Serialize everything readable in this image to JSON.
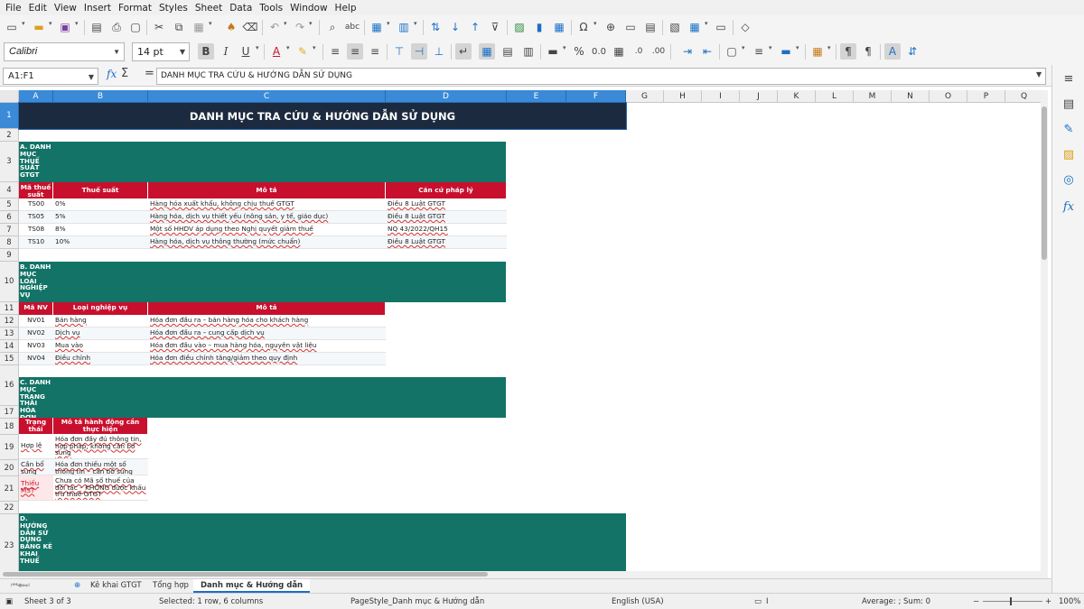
{
  "menu": [
    "File",
    "Edit",
    "View",
    "Insert",
    "Format",
    "Styles",
    "Sheet",
    "Data",
    "Tools",
    "Window",
    "Help"
  ],
  "toolbar": {
    "font_name": "Calibri",
    "font_size": "14 pt",
    "icons": [
      "new-doc",
      "open",
      "save",
      "export-pdf",
      "print",
      "print-preview",
      "cut",
      "copy",
      "paste",
      "clone-format",
      "clear-format",
      "undo",
      "redo",
      "find-replace",
      "spellcheck",
      "row",
      "column",
      "sort",
      "sort-ascending",
      "sort-descending",
      "autofilter",
      "image",
      "chart",
      "pivot-table",
      "special-character",
      "hyperlink",
      "comment",
      "header-footer",
      "define-print-area",
      "freeze",
      "split",
      "show-draw",
      "bold",
      "italic",
      "underline",
      "font-color",
      "highlight",
      "align-left",
      "align-center",
      "align-right",
      "align-top",
      "align-middle",
      "align-bottom",
      "wrap-text",
      "merge-center",
      "merge",
      "unmerge",
      "currency",
      "percent",
      "number",
      "date",
      "add-decimal",
      "delete-decimal",
      "increase-indent",
      "decrease-indent",
      "borders",
      "border-style",
      "border-color",
      "conditional",
      "left-to-right",
      "right-to-left",
      "text-direction-ltr",
      "text-direction-ttb"
    ]
  },
  "formula_bar": {
    "cell_ref": "A1:F1",
    "fx": "fx",
    "sigma": "Σ",
    "equals": "=",
    "content": "DANH MỤC TRA CỨU & HƯỚNG DẪN SỬ DỤNG"
  },
  "columns": [
    "A",
    "B",
    "C",
    "D",
    "E",
    "F",
    "G",
    "H",
    "I",
    "J",
    "K",
    "L",
    "M",
    "N",
    "O",
    "P",
    "Q"
  ],
  "rows": [
    "1",
    "2",
    "3",
    "4",
    "5",
    "6",
    "7",
    "8",
    "9",
    "10",
    "11",
    "12",
    "13",
    "14",
    "15",
    "16",
    "17",
    "18",
    "19",
    "20",
    "21",
    "22",
    "23"
  ],
  "sheet": {
    "title": "DANH MỤC TRA CỨU & HƯỚNG DẪN SỬ DỤNG",
    "section_a": {
      "heading": "A. DANH MỤC THUẾ SUẤT GTGT",
      "headers": [
        "Mã thuế suất",
        "Thuế suất",
        "Mô tả",
        "Căn cứ pháp lý"
      ],
      "rows": [
        [
          "TS00",
          "0%",
          "Hàng hóa xuất khẩu, không chịu thuế GTGT",
          "Điều 8 Luật GTGT"
        ],
        [
          "TS05",
          "5%",
          "Hàng hóa, dịch vụ thiết yếu (nông sản, y tế, giáo dục)",
          "Điều 8 Luật GTGT"
        ],
        [
          "TS08",
          "8%",
          "Một số HHDV áp dụng theo Nghị quyết giảm thuế",
          "NQ 43/2022/QH15"
        ],
        [
          "TS10",
          "10%",
          "Hàng hóa, dịch vụ thông thường (mức chuẩn)",
          "Điều 8 Luật GTGT"
        ]
      ]
    },
    "section_b": {
      "heading": "B. DANH MỤC LOẠI NGHIỆP VỤ",
      "headers": [
        "Mã NV",
        "Loại nghiệp vụ",
        "Mô tả"
      ],
      "rows": [
        [
          "NV01",
          "Bán hàng",
          "Hóa đơn đầu ra – bán hàng hóa cho khách hàng"
        ],
        [
          "NV02",
          "Dịch vụ",
          "Hóa đơn đầu ra – cung cấp dịch vụ"
        ],
        [
          "NV03",
          "Mua vào",
          "Hóa đơn đầu vào – mua hàng hóa, nguyên vật liệu"
        ],
        [
          "NV04",
          "Điều chỉnh",
          "Hóa đơn điều chỉnh tăng/giảm theo quy định"
        ]
      ]
    },
    "section_c": {
      "heading": "C. DANH MỤC TRẠNG THÁI HÓA ĐƠN",
      "headers": [
        "Trạng thái",
        "Mô tả hành động cần thực hiện"
      ],
      "rows": [
        [
          "Hợp lệ",
          "Hóa đơn đầy đủ thông tin, hợp pháp, không cần bổ sung"
        ],
        [
          "Cần bổ sung",
          "Hóa đơn thiếu một số thông tin – cần bổ sung chứng từ"
        ],
        [
          "Thiếu MST",
          "Chưa có Mã số thuế của đối tác – KHÔNG được khấu trừ thuế GTGT"
        ]
      ]
    },
    "section_d": {
      "heading": "D. HƯỚNG DẪN SỬ DỤNG BẢNG KÊ KHAI THUẾ"
    }
  },
  "tabs": [
    "Kê khai GTGT",
    "Tổng hợp",
    "Danh mục & Hướng dẫn"
  ],
  "status": {
    "sheet": "Sheet 3 of 3",
    "selection": "Selected: 1 row, 6 columns",
    "page_style": "PageStyle_Danh mục & Hướng dẫn",
    "language": "English (USA)",
    "summary": "Average: ; Sum: 0",
    "zoom": "100%"
  },
  "colors": {
    "title_bg": "#1c2a3f",
    "section_bg": "#127366",
    "header_bg": "#c8102e",
    "selection": "#3a8ad8"
  }
}
